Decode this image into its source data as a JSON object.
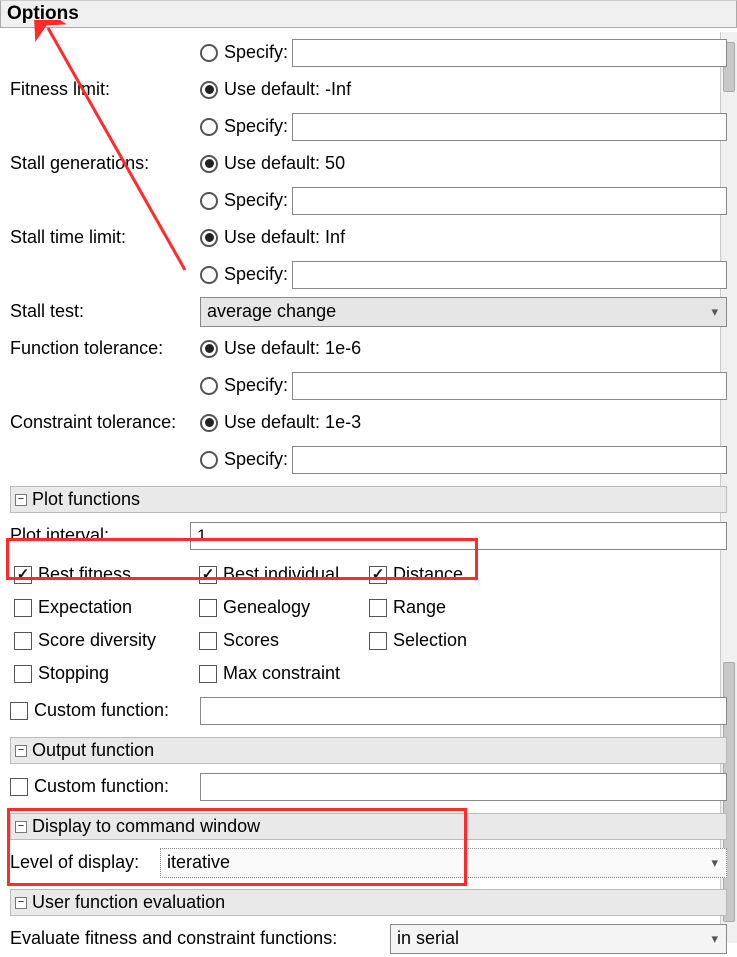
{
  "title": "Options",
  "rows": {
    "specify": "Specify:",
    "fitness_limit": {
      "label": "Fitness limit:",
      "def": "Use default: -Inf"
    },
    "stall_gen": {
      "label": "Stall generations:",
      "def": "Use default: 50"
    },
    "stall_time": {
      "label": "Stall time limit:",
      "def": "Use default: Inf"
    },
    "stall_test": {
      "label": "Stall test:",
      "value": "average change"
    },
    "func_tol": {
      "label": "Function tolerance:",
      "def": "Use default: 1e-6"
    },
    "con_tol": {
      "label": "Constraint tolerance:",
      "def": "Use default: 1e-3"
    }
  },
  "plot": {
    "header": "Plot functions",
    "interval_label": "Plot interval:",
    "interval_value": "1",
    "checks": {
      "best_fitness": "Best fitness",
      "best_individual": "Best individual",
      "distance": "Distance",
      "expectation": "Expectation",
      "genealogy": "Genealogy",
      "range": "Range",
      "score_diversity": "Score diversity",
      "scores": "Scores",
      "selection": "Selection",
      "stopping": "Stopping",
      "max_constraint": "Max constraint"
    },
    "custom_label": "Custom function:"
  },
  "output": {
    "header": "Output function",
    "custom_label": "Custom function:"
  },
  "display": {
    "header": "Display to command window",
    "level_label": "Level of display:",
    "level_value": "iterative"
  },
  "userfn": {
    "header": "User function evaluation",
    "eval_label": "Evaluate fitness and constraint functions:",
    "eval_value": "in serial"
  }
}
